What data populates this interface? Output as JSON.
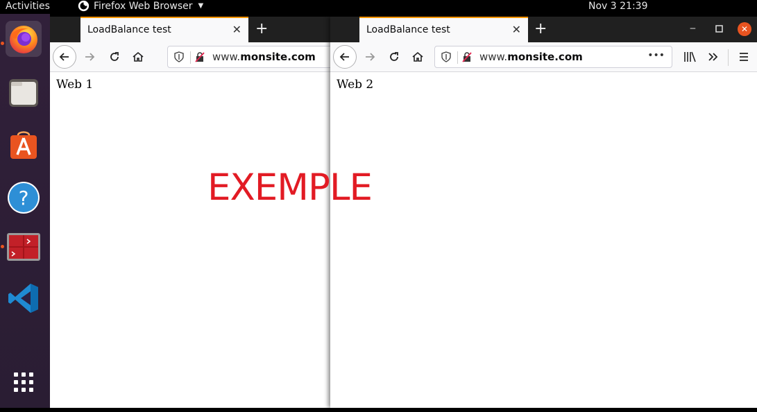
{
  "topbar": {
    "activities": "Activities",
    "app_name": "Firefox Web Browser",
    "clock": "Nov 3  21:39"
  },
  "dock": {
    "items": [
      {
        "name": "Firefox",
        "icon": "firefox-icon"
      },
      {
        "name": "Files",
        "icon": "files-icon"
      },
      {
        "name": "Ubuntu Software",
        "icon": "software-store-icon"
      },
      {
        "name": "Help",
        "icon": "help-icon"
      },
      {
        "name": "Terminal",
        "icon": "terminal-icon"
      },
      {
        "name": "Visual Studio Code",
        "icon": "vscode-icon"
      },
      {
        "name": "Show Applications",
        "icon": "app-grid-icon"
      }
    ],
    "help_glyph": "?",
    "accent": "#e95420"
  },
  "windows": {
    "left": {
      "tab_title": "LoadBalance test",
      "url_prefix": "www.",
      "url_domain": "monsite.com",
      "page_text": "Web 1"
    },
    "right": {
      "tab_title": "LoadBalance test",
      "url_prefix": "www.",
      "url_domain": "monsite.com",
      "page_text": "Web 2",
      "page_actions": "•••"
    }
  },
  "watermark": {
    "text": "EXEMPLE",
    "color": "#e21b24"
  }
}
